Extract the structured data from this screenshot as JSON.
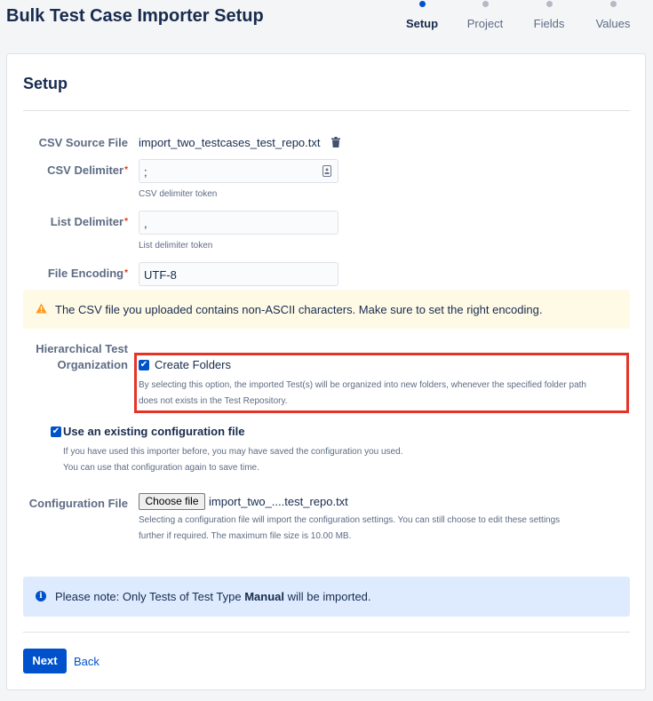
{
  "header": {
    "title": "Bulk Test Case Importer Setup",
    "steps": [
      {
        "label": "Setup",
        "active": true
      },
      {
        "label": "Project",
        "active": false
      },
      {
        "label": "Fields",
        "active": false
      },
      {
        "label": "Values",
        "active": false
      }
    ]
  },
  "card": {
    "title": "Setup"
  },
  "form": {
    "csv_source": {
      "label": "CSV Source File",
      "value": "import_two_testcases_test_repo.txt",
      "icon": "trash-icon"
    },
    "csv_delimiter": {
      "label": "CSV Delimiter",
      "value": ";",
      "help": "CSV delimiter token",
      "required": "*"
    },
    "list_delimiter": {
      "label": "List Delimiter",
      "value": ",",
      "help": "List delimiter token",
      "required": "*"
    },
    "file_encoding": {
      "label": "File Encoding",
      "value": "UTF-8",
      "required": "*"
    },
    "warning": "The CSV file you uploaded contains non-ASCII characters. Make sure to set the right encoding.",
    "hierarchical": {
      "label_line1": "Hierarchical Test",
      "label_line2": "Organization",
      "checkbox_label": "Create Folders",
      "checked": true,
      "help_line1": "By selecting this option, the imported Test(s) will be organized into new folders, whenever the specified folder path",
      "help_line2": "does not exists in the Test Repository."
    },
    "existing_config": {
      "checkbox_label": "Use an existing configuration file",
      "checked": true,
      "help_line1": "If you have used this importer before, you may have saved the configuration you used.",
      "help_line2": "You can use that configuration again to save time."
    },
    "config_file": {
      "label": "Configuration File",
      "button_label": "Choose file",
      "file_name": "import_two_....test_repo.txt",
      "help_line1": "Selecting a configuration file will import the configuration settings. You can still choose to edit these settings",
      "help_line2": "further if required. The maximum file size is 10.00 MB."
    },
    "note": {
      "prefix": "Please note: Only Tests of Test Type ",
      "emphasis": "Manual",
      "suffix": " will be imported."
    }
  },
  "footer": {
    "next_label": "Next",
    "back_label": "Back"
  },
  "colors": {
    "primary": "#0052cc",
    "warning_bg": "#fffae6",
    "info_bg": "#deebff",
    "required": "#de350b",
    "highlight": "#e53328"
  }
}
